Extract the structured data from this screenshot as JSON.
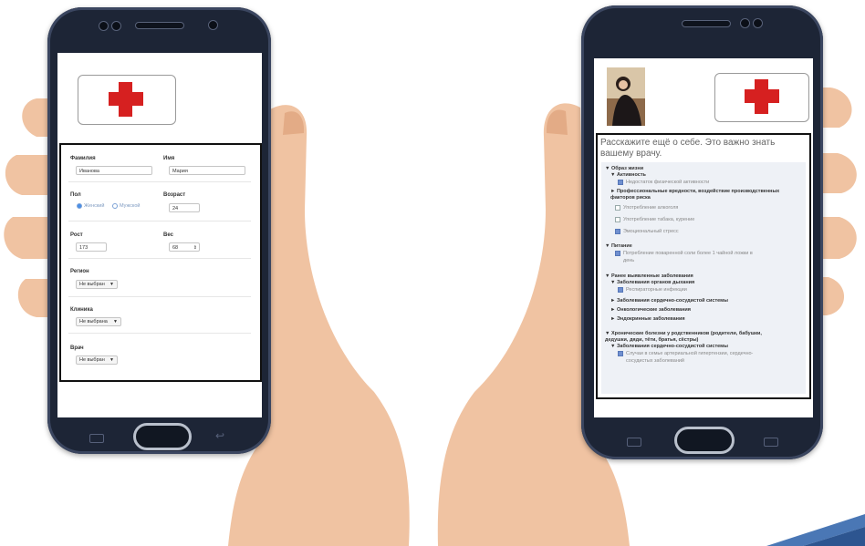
{
  "left_phone": {
    "form": {
      "surname_label": "Фамилия",
      "surname_value": "Иванова",
      "name_label": "Имя",
      "name_value": "Мария",
      "gender_label": "Пол",
      "gender_female": "Женский",
      "gender_male": "Мужской",
      "gender_selected": "Женский",
      "age_label": "Возраст",
      "age_value": "24",
      "height_label": "Рост",
      "height_value": "173",
      "weight_label": "Вес",
      "weight_value": "68",
      "region_label": "Регион",
      "region_value": "Не выбран",
      "clinic_label": "Клиника",
      "clinic_value": "Не выбрана",
      "doctor_label": "Врач",
      "doctor_value": "Не выбран"
    }
  },
  "right_phone": {
    "prompt": "Расскажите ещё о себе. Это важно знать вашему врачу.",
    "tree": [
      {
        "text": "▼ Образ жизни",
        "bold": true
      },
      {
        "text": "▼ Активность",
        "bold": true
      },
      {
        "text": "Недостаток физической активности",
        "checked": true
      },
      {
        "text": "► Профессиональные вредности, воздействие производственных",
        "bold": true
      },
      {
        "text": "факторов риска",
        "bold": true
      },
      {
        "text": "Употребление алкоголя",
        "checked": false
      },
      {
        "text": "Употребление табака, курение",
        "checked": false
      },
      {
        "text": "Эмоциональный стресс",
        "checked": true
      },
      {
        "text": "▼ Питание",
        "bold": true
      },
      {
        "text": "Потребление поваренной соли более 1 чайной ложки в",
        "checked": true
      },
      {
        "text": "день",
        "checked": null
      },
      {
        "text": "▼ Ранее выявленные заболевания",
        "bold": true
      },
      {
        "text": "▼ Заболевания органов дыхания",
        "bold": true
      },
      {
        "text": "Респираторные инфекции",
        "checked": true
      },
      {
        "text": "► Заболевания сердечно-сосудистой системы",
        "bold": true
      },
      {
        "text": "► Онкологические заболевания",
        "bold": true
      },
      {
        "text": "► Эндокринные заболевания",
        "bold": true
      },
      {
        "text": "▼ Хронические болезни у родственников (родители, бабушки,",
        "bold": true
      },
      {
        "text": "дедушки, дяди, тёти, братья, сёстры)",
        "bold": true
      },
      {
        "text": "▼ Заболевания сердечно-сосудистой системы",
        "bold": true
      },
      {
        "text": "Случаи в семье артериальной гипертензии, сердечно-",
        "checked": true
      },
      {
        "text": "сосудистых заболеваний",
        "checked": null
      }
    ]
  },
  "icons": {
    "logo": "red-cross-icon",
    "dropdown": "chevron-down-icon",
    "stepper": "stepper-icon"
  },
  "colors": {
    "cross": "#d62020",
    "phone_body": "#1d2536",
    "skin": "#f0c3a2",
    "accent": "#4a8fe7"
  }
}
